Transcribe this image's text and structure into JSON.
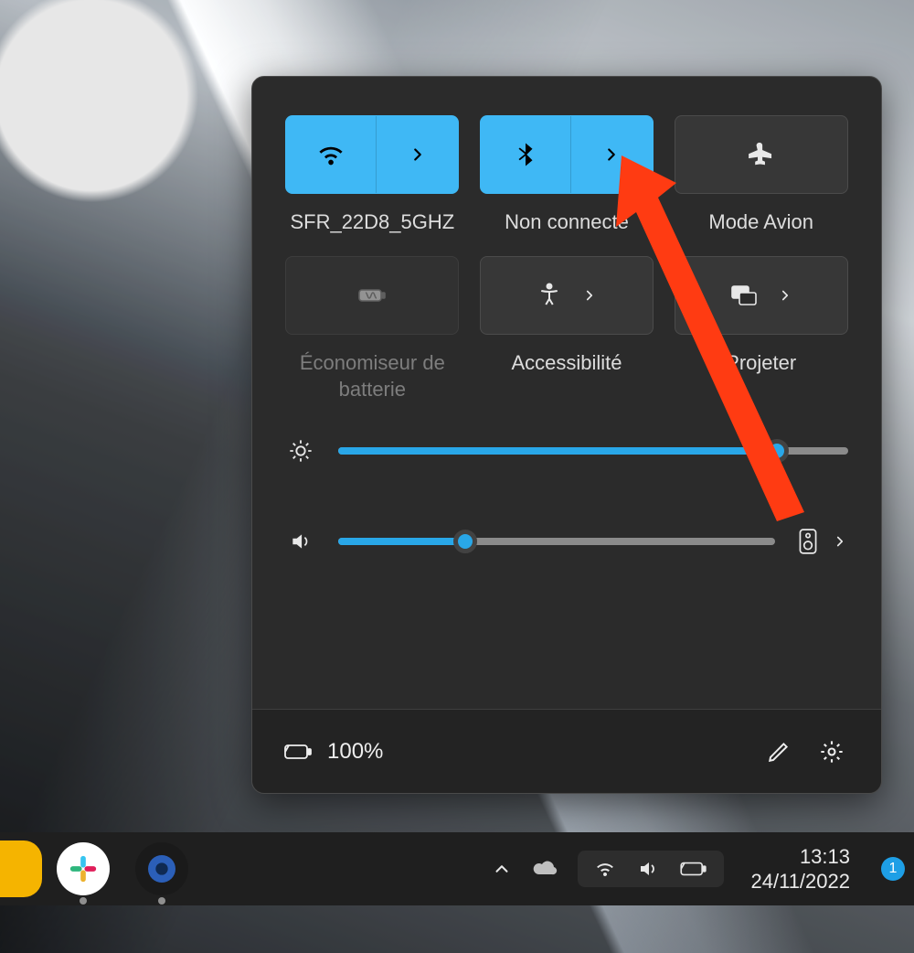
{
  "quick_settings": {
    "tiles": [
      {
        "id": "wifi",
        "label": "SFR_22D8_5GHZ",
        "active": true,
        "split": true,
        "icon": "wifi-icon"
      },
      {
        "id": "bluetooth",
        "label": "Non connecté",
        "active": true,
        "split": true,
        "icon": "bluetooth-icon"
      },
      {
        "id": "airplane",
        "label": "Mode Avion",
        "active": false,
        "split": false,
        "icon": "airplane-icon"
      },
      {
        "id": "battery-saver",
        "label": "Économiseur de batterie",
        "active": false,
        "split": false,
        "dim": true,
        "icon": "battery-saver-icon"
      },
      {
        "id": "accessibility",
        "label": "Accessibilité",
        "active": false,
        "split": false,
        "inline_arrow": true,
        "icon": "accessibility-icon"
      },
      {
        "id": "project",
        "label": "Projeter",
        "active": false,
        "split": false,
        "inline_arrow": true,
        "icon": "project-icon"
      }
    ],
    "brightness_percent": 86,
    "volume_percent": 29,
    "battery_text": "100%"
  },
  "taskbar": {
    "time": "13:13",
    "date": "24/11/2022",
    "notifications": "1"
  },
  "colors": {
    "accent": "#29a7e8",
    "tile_active": "#3fb8f5",
    "panel": "#2b2b2b"
  }
}
